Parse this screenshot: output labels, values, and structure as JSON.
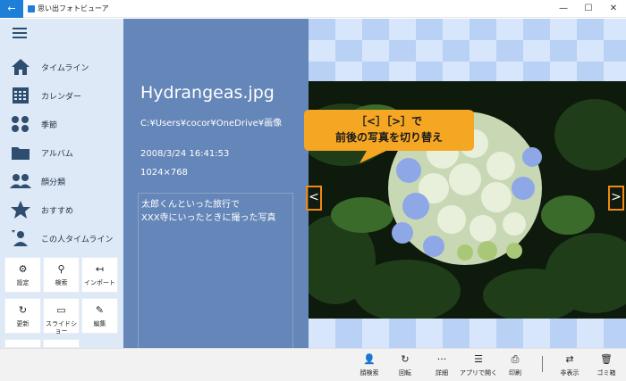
{
  "window": {
    "title": "思い出フォトビューア",
    "back_icon": "←",
    "minimize_icon": "—",
    "maximize_icon": "☐",
    "close_icon": "✕"
  },
  "sidebar": {
    "items": [
      {
        "label": "タイムライン",
        "icon": "home-icon"
      },
      {
        "label": "カレンダー",
        "icon": "calendar-icon"
      },
      {
        "label": "季節",
        "icon": "seasons-icon"
      },
      {
        "label": "アルバム",
        "icon": "folder-icon"
      },
      {
        "label": "顔分類",
        "icon": "faces-icon"
      },
      {
        "label": "おすすめ",
        "icon": "star-icon"
      },
      {
        "label": "この人タイムライン",
        "icon": "person-timeline-icon"
      }
    ],
    "tiles": [
      {
        "label": "設定",
        "icon": "⚙"
      },
      {
        "label": "検索",
        "icon": "⚲"
      },
      {
        "label": "インポート",
        "icon": "↤"
      },
      {
        "label": "更新",
        "icon": "↻"
      },
      {
        "label": "スライドショー",
        "icon": "▭"
      },
      {
        "label": "編集",
        "icon": "✎"
      }
    ]
  },
  "info": {
    "filename": "Hydrangeas.jpg",
    "path": "C:¥Users¥cocor¥OneDrive¥画像",
    "date": "2008/3/24 16:41:53",
    "dimensions": "1024×768",
    "comment": "太郎くんといった旅行で\nXXX寺にいったときに撮った写真"
  },
  "viewer": {
    "prev_icon": "<",
    "next_icon": ">",
    "callout_line1": "［<］［>］で",
    "callout_line2": "前後の写真を切り替え"
  },
  "toolbar": {
    "buttons": [
      {
        "label": "顔検索",
        "icon": "👤"
      },
      {
        "label": "回転",
        "icon": "↻"
      },
      {
        "label": "詳細",
        "icon": "···"
      },
      {
        "label": "アプリで開く",
        "icon": "☰"
      },
      {
        "label": "印刷",
        "icon": "⎙"
      },
      {
        "label": "非表示",
        "icon": "⇄"
      },
      {
        "label": "ゴミ箱",
        "icon": "🗑"
      }
    ]
  },
  "colors": {
    "accent": "#1e7fd8",
    "sidebar_bg": "#dde9f7",
    "info_bg": "#6486b8",
    "callout_orange": "#f5a623",
    "arrow_border": "#f08a10"
  }
}
